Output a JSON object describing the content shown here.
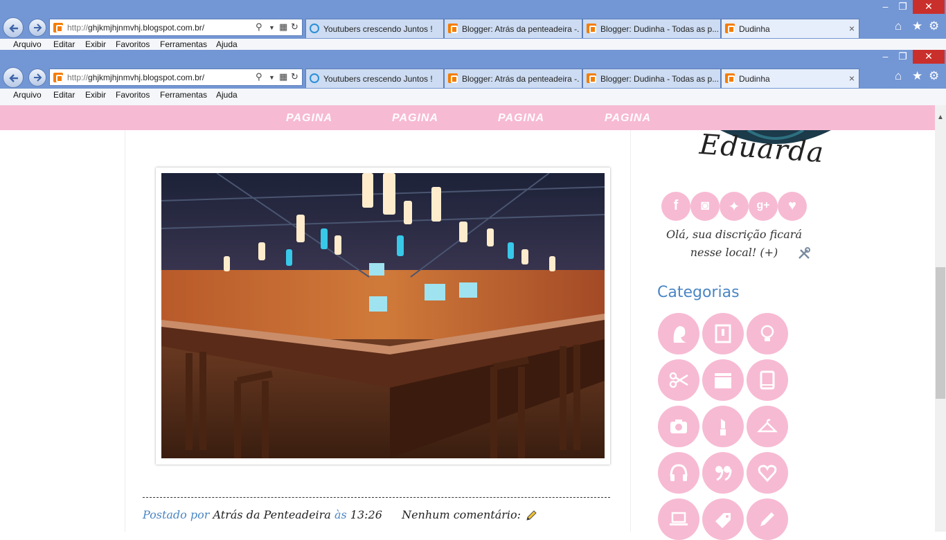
{
  "browser": {
    "address_prefix": "http://",
    "address_host": "ghjkmjhjnmvhj.blogspot.com.br/",
    "tabs": [
      {
        "label": "Youtubers crescendo Juntos !"
      },
      {
        "label": "Blogger: Atrás da penteadeira -..."
      },
      {
        "label": "Blogger: Dudinha - Todas as p..."
      },
      {
        "label": "Dudinha"
      }
    ],
    "tab_close_glyph": "×",
    "menu": [
      "Arquivo",
      "Editar",
      "Exibir",
      "Favoritos",
      "Ferramentas",
      "Ajuda"
    ],
    "window_controls": {
      "minimize": "–",
      "restore": "❐",
      "close": "✕"
    },
    "toolbar_icons": [
      "home-icon",
      "star-icon",
      "gear-icon"
    ]
  },
  "blog": {
    "nav": [
      "PAGINA",
      "PAGINA",
      "PAGINA",
      "PAGINA"
    ],
    "signature": "Eduarda",
    "description": "Olá, sua discrição ficará nesse local! (+)",
    "social_icons": [
      "facebook-icon",
      "instagram-icon",
      "twitter-icon",
      "google-plus-icon",
      "heart-icon"
    ],
    "categories_title": "Categorias",
    "category_icons": [
      "woman-icon",
      "frame-icon",
      "bulb-icon",
      "scissors-icon",
      "clapper-icon",
      "book-icon",
      "camera-icon",
      "lipstick-icon",
      "hanger-icon",
      "headphones-icon",
      "quote-icon",
      "heart-icon",
      "laptop-icon",
      "tag-icon",
      "pencil-icon"
    ],
    "post": {
      "posted_by": "Postado por",
      "author": "Atrás da Penteadeira",
      "at": "às",
      "time": "13:26",
      "comments": "Nenhum comentário:"
    }
  },
  "colors": {
    "chrome": "#7396d4",
    "pink": "#f7bad3",
    "link_blue": "#4a86c5"
  }
}
